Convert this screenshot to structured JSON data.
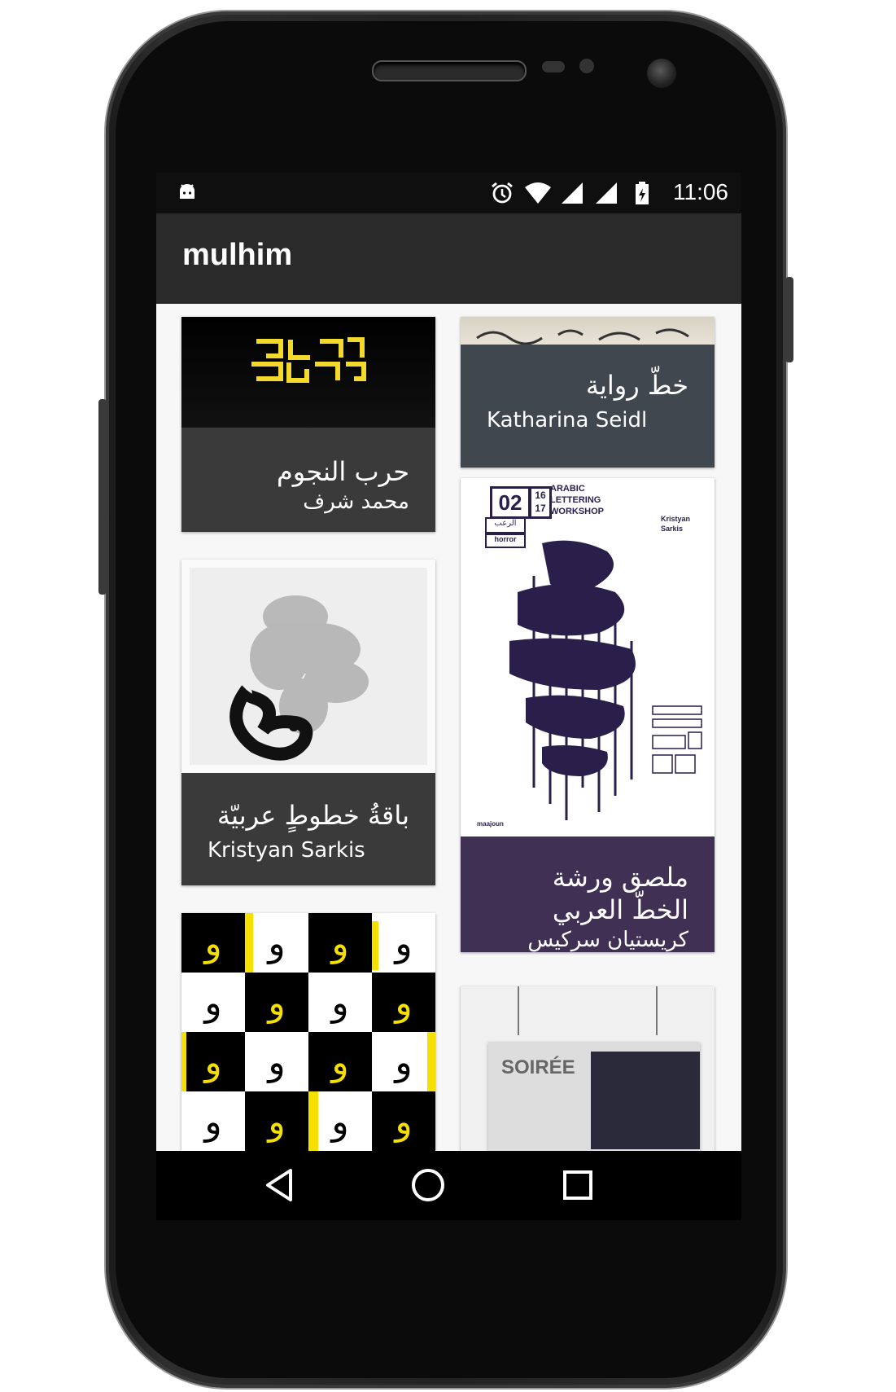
{
  "status": {
    "time": "11:06",
    "icons": [
      "android-debug-icon",
      "alarm-icon",
      "wifi-icon",
      "signal-icon",
      "signal-icon-2",
      "battery-charging-icon"
    ]
  },
  "toolbar": {
    "title": "mulhim"
  },
  "cards": [
    {
      "title": "حرب النجوم",
      "subtitle": "محمد شرف",
      "color": "#3a3a3a"
    },
    {
      "title": "خطّ رواية",
      "subtitle": "Katharina Seidl",
      "color": "#41474e"
    },
    {
      "title": "باقةُ خطوطٍ عربيّة",
      "subtitle": "Kristyan Sarkis",
      "color": "#3a3a3a"
    },
    {
      "title": "ملصق ورشة الخطّ العربي",
      "subtitle": "كريستيان سركيس",
      "color": "#3f3054"
    }
  ],
  "poster": {
    "episode": "02",
    "dates": "16 17",
    "headline": "ARABIC LETTERING WORKSHOP",
    "brand": "maajoun",
    "artist": "Kristyan Sarkis",
    "tag1": "الرعب",
    "tag2": "horror"
  },
  "partial_card": {
    "text": "SOIRÉE"
  },
  "navigation": {
    "back": "back-icon",
    "home": "home-icon",
    "recents": "recents-icon"
  }
}
